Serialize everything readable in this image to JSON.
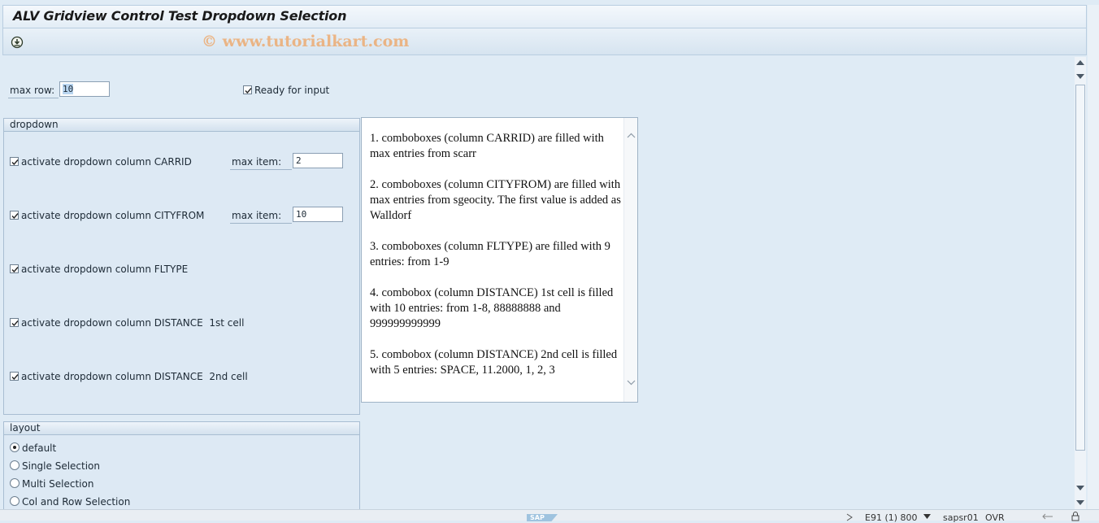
{
  "window": {
    "title": "ALV Gridview Control Test Dropdown Selection",
    "watermark": "© www.tutorialkart.com"
  },
  "top": {
    "max_row_label": "max row:",
    "max_row_value": "10",
    "ready_label": "Ready for input",
    "ready_checked": true
  },
  "dropdown": {
    "title": "dropdown",
    "max_item_label": "max item:",
    "items": [
      {
        "label": "activate dropdown column CARRID",
        "checked": true,
        "max_item": "2"
      },
      {
        "label": "activate dropdown column CITYFROM",
        "checked": true,
        "max_item": "10"
      },
      {
        "label": "activate dropdown column FLTYPE",
        "checked": true
      },
      {
        "label": "activate dropdown column DISTANCE  1st cell",
        "checked": true
      },
      {
        "label": "activate dropdown column DISTANCE  2nd cell",
        "checked": true
      }
    ]
  },
  "layout": {
    "title": "layout",
    "options": [
      {
        "label": "default",
        "selected": true
      },
      {
        "label": "Single Selection",
        "selected": false
      },
      {
        "label": "Multi Selection",
        "selected": false
      },
      {
        "label": "Col and Row Selection",
        "selected": false
      }
    ]
  },
  "info_text": {
    "paragraphs": [
      "1. comboboxes (column CARRID) are filled with max entries from scarr",
      "2. comboboxes (column CITYFROM) are filled with max entries from sgeocity. The first value is added as Walldorf",
      "3. comboboxes (column FLTYPE) are filled with 9 entries: from 1-9",
      "4. combobox (column DISTANCE) 1st cell is filled with 10 entries: from 1-8, 88888888 and 999999999999",
      "5. combobox (column DISTANCE) 2nd cell is filled with 5 entries: SPACE, 11.2000, 1, 2, 3"
    ]
  },
  "status_bar": {
    "sap_logo": "SAP",
    "system": "E91 (1) 800",
    "user": "sapsr01",
    "mode": "OVR"
  },
  "colors": {
    "background": "#dfebf5",
    "watermark": "#eea05a"
  }
}
